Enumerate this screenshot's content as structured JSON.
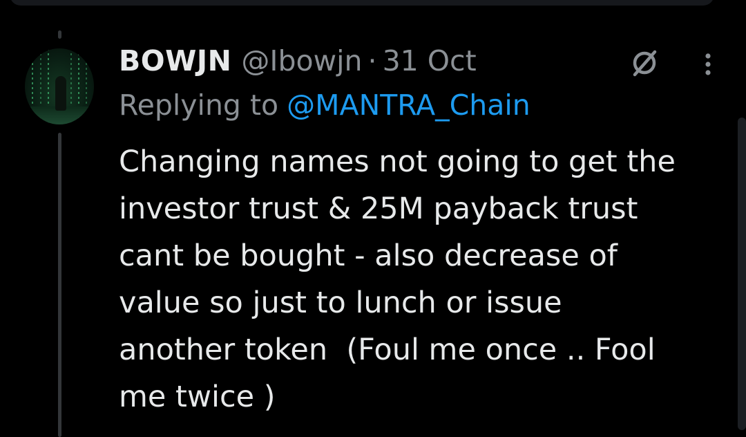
{
  "tweet": {
    "author": {
      "display_name": "BOWJN",
      "handle": "@Ibowjn",
      "avatar_icon": "matrix-figure-avatar"
    },
    "separator": "·",
    "date": "31 Oct",
    "replying_to": {
      "prefix": "Replying to",
      "mention": "@MANTRA_Chain"
    },
    "body_lines": [
      "Changing names not going to get the",
      "investor trust & 25M payback trust",
      "cant be bought - also decrease of",
      "value so just to lunch or issue",
      "another token  (Foul me once .. Fool",
      "me twice )"
    ]
  },
  "icons": {
    "grok": "grok-icon",
    "more": "more-options-icon"
  },
  "colors": {
    "background": "#000000",
    "text": "#e7e9ea",
    "secondary": "#8b9095",
    "link": "#1d9bf0",
    "thread_line": "#333639"
  }
}
